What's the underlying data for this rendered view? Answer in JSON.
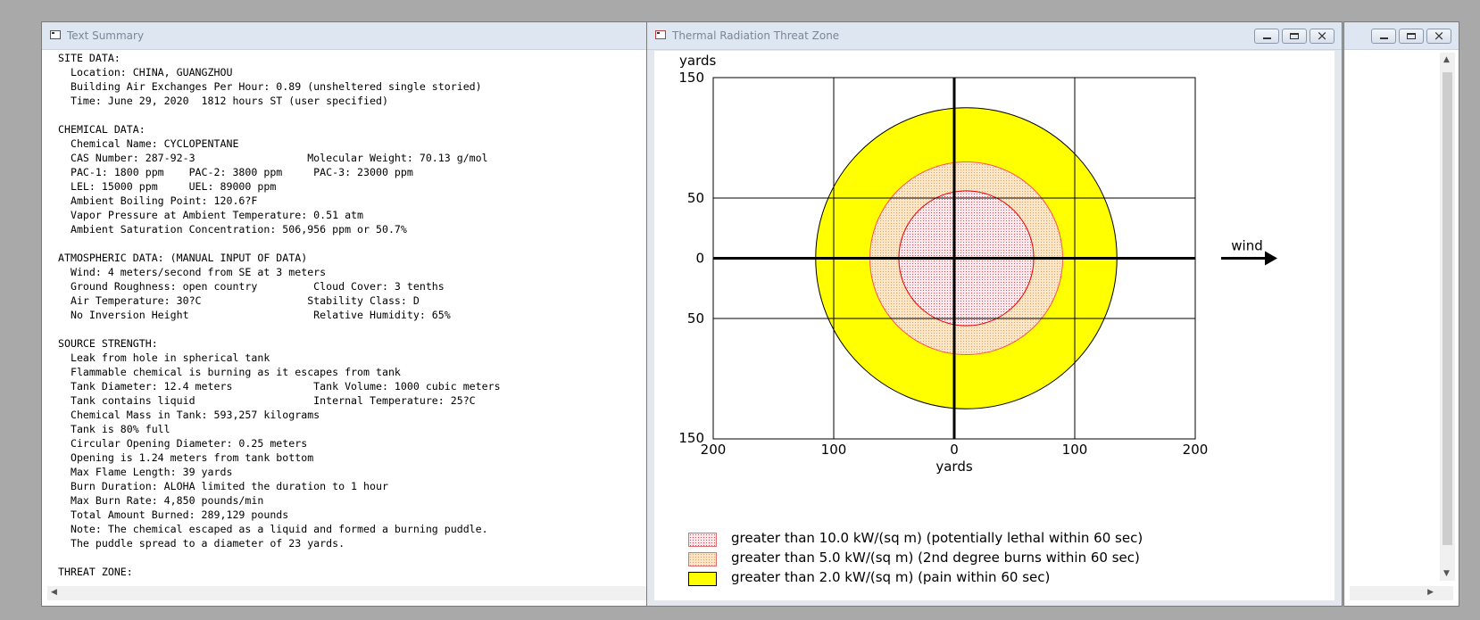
{
  "windows": {
    "text_summary": {
      "title": "Text Summary"
    },
    "threat_zone": {
      "title": "Thermal Radiation Threat Zone"
    }
  },
  "text_lines": [
    "SITE DATA:",
    "  Location: CHINA, GUANGZHOU",
    "  Building Air Exchanges Per Hour: 0.89 (unsheltered single storied)",
    "  Time: June 29, 2020  1812 hours ST (user specified)",
    "",
    "CHEMICAL DATA:",
    "  Chemical Name: CYCLOPENTANE",
    "  CAS Number: 287-92-3                  Molecular Weight: 70.13 g/mol",
    "  PAC-1: 1800 ppm    PAC-2: 3800 ppm     PAC-3: 23000 ppm",
    "  LEL: 15000 ppm     UEL: 89000 ppm",
    "  Ambient Boiling Point: 120.6?F",
    "  Vapor Pressure at Ambient Temperature: 0.51 atm",
    "  Ambient Saturation Concentration: 506,956 ppm or 50.7%",
    "",
    "ATMOSPHERIC DATA: (MANUAL INPUT OF DATA)",
    "  Wind: 4 meters/second from SE at 3 meters",
    "  Ground Roughness: open country         Cloud Cover: 3 tenths",
    "  Air Temperature: 30?C                 Stability Class: D",
    "  No Inversion Height                    Relative Humidity: 65%",
    "",
    "SOURCE STRENGTH:",
    "  Leak from hole in spherical tank",
    "  Flammable chemical is burning as it escapes from tank",
    "  Tank Diameter: 12.4 meters             Tank Volume: 1000 cubic meters",
    "  Tank contains liquid                   Internal Temperature: 25?C",
    "  Chemical Mass in Tank: 593,257 kilograms",
    "  Tank is 80% full",
    "  Circular Opening Diameter: 0.25 meters",
    "  Opening is 1.24 meters from tank bottom",
    "  Max Flame Length: 39 yards",
    "  Burn Duration: ALOHA limited the duration to 1 hour",
    "  Max Burn Rate: 4,850 pounds/min",
    "  Total Amount Burned: 289,129 pounds",
    "  Note: The chemical escaped as a liquid and formed a burning puddle.",
    "  The puddle spread to a diameter of 23 yards.",
    "",
    "THREAT ZONE:"
  ],
  "chart_data": {
    "type": "threat-zone-map",
    "xlabel": "yards",
    "ylabel": "yards",
    "xlim": [
      -200,
      200
    ],
    "ylim": [
      -150,
      150
    ],
    "x_tick_labels": [
      "200",
      "100",
      "0",
      "100",
      "200"
    ],
    "y_tick_labels": [
      "150",
      "50",
      "0",
      "50",
      "150"
    ],
    "x_ticks": [
      -200,
      -100,
      0,
      100,
      200
    ],
    "y_ticks": [
      150,
      50,
      0,
      -50,
      -150
    ],
    "grid": true,
    "wind_label": "wind",
    "wind_direction": "right",
    "zones": [
      {
        "label": "greater than 2.0 kW/(sq m) (pain within 60 sec)",
        "center_x": 10,
        "center_y": 0,
        "radius": 125,
        "fill": "#ffff00",
        "stroke": "#000000"
      },
      {
        "label": "greater than 5.0 kW/(sq m) (2nd degree burns within 60 sec)",
        "center_x": 10,
        "center_y": 0,
        "radius": 80,
        "fill": "#fbe6c8",
        "stroke": "#ff5050"
      },
      {
        "label": "greater than 10.0 kW/(sq m) (potentially lethal within 60 sec)",
        "center_x": 10,
        "center_y": 0,
        "radius": 56,
        "fill": "#fde8ee",
        "stroke": "#e00000"
      }
    ]
  },
  "legend": [
    {
      "label": "greater than 10.0 kW/(sq m) (potentially lethal within 60 sec)",
      "fill": "#fde8ee",
      "dots": "#e05050"
    },
    {
      "label": "greater than 5.0 kW/(sq m) (2nd degree burns within 60 sec)",
      "fill": "#fbe6c8",
      "dots": "#e8a060"
    },
    {
      "label": "greater than 2.0 kW/(sq m) (pain within 60 sec)",
      "fill": "#ffff00",
      "dots": ""
    }
  ]
}
